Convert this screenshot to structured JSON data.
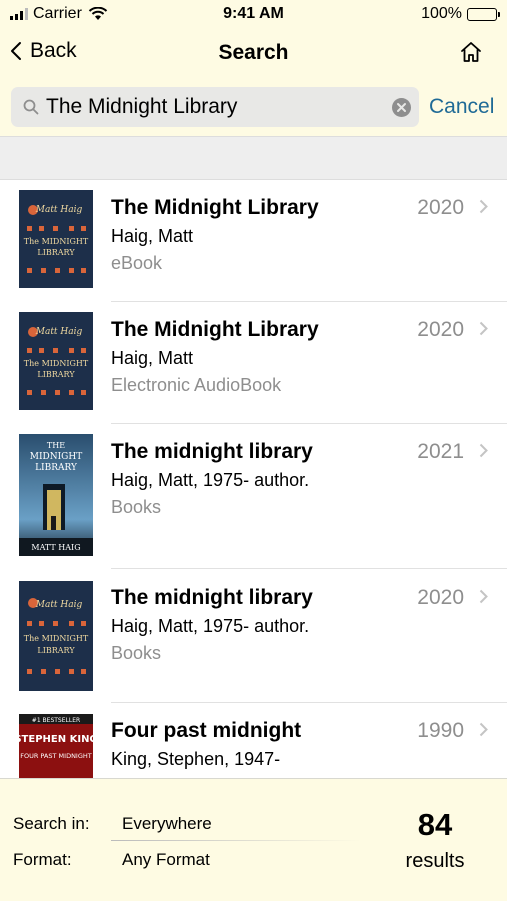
{
  "status": {
    "carrier": "Carrier",
    "time": "9:41 AM",
    "battery": "100%"
  },
  "nav": {
    "back_label": "Back",
    "title": "Search"
  },
  "search": {
    "query": "The Midnight Library",
    "cancel_label": "Cancel"
  },
  "results": [
    {
      "title": "The Midnight Library",
      "author": "Haig, Matt",
      "format": "eBook",
      "year": "2020",
      "cover": {
        "bg": "#1d2f4a",
        "line1": "Matt Haig",
        "line2": "The MIDNIGHT",
        "line3": "LIBRARY"
      }
    },
    {
      "title": "The Midnight Library",
      "author": "Haig, Matt",
      "format": "Electronic AudioBook",
      "year": "2020",
      "cover": {
        "bg": "#1d2f4a",
        "line1": "Matt Haig",
        "line2": "The MIDNIGHT",
        "line3": "LIBRARY"
      }
    },
    {
      "title": "The midnight library",
      "author": "Haig, Matt, 1975- author.",
      "format": "Books",
      "year": "2021",
      "cover": {
        "bg": "#2a4e6e",
        "line1": "THE",
        "line2": "MIDNIGHT",
        "line3": "LIBRARY",
        "line4": "MATT HAIG"
      }
    },
    {
      "title": "The midnight library",
      "author": "Haig, Matt, 1975- author.",
      "format": "Books",
      "year": "2020",
      "cover": {
        "bg": "#1d2f4a",
        "line1": "Matt Haig",
        "line2": "The MIDNIGHT",
        "line3": "LIBRARY"
      }
    },
    {
      "title": "Four past midnight",
      "author": "King, Stephen, 1947-",
      "format": "",
      "year": "1990",
      "cover": {
        "bg": "#8c1010",
        "line1": "#1 BESTSELLER",
        "line2": "STEPHEN KING",
        "line3": "FOUR PAST MIDNIGHT"
      }
    }
  ],
  "footer": {
    "search_in_label": "Search in:",
    "search_in_value": "Everywhere",
    "format_label": "Format:",
    "format_value": "Any Format",
    "count": "84",
    "count_label": "results"
  },
  "colors": {
    "bar_bg": "#fefbe3",
    "accent": "#1f6a96",
    "secondary_text": "#8e8e8e"
  }
}
